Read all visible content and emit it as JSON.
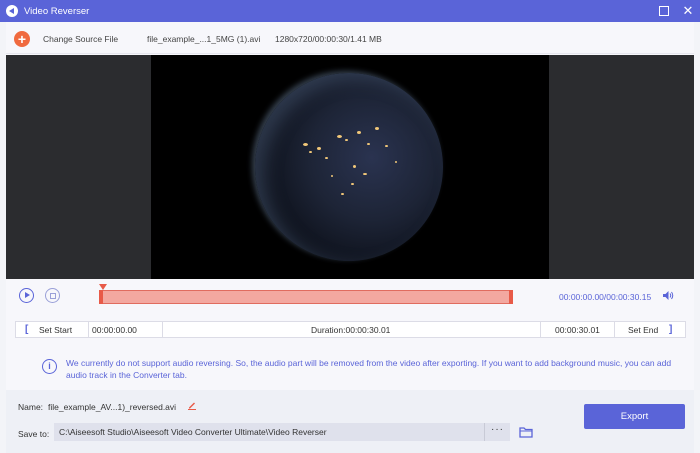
{
  "window": {
    "title": "Video Reverser"
  },
  "source": {
    "change_label": "Change Source File",
    "file_name": "file_example_...1_5MG (1).avi",
    "file_meta": "1280x720/00:00:30/1.41 MB"
  },
  "timeline": {
    "time_readout": "00:00:00.00/00:00:30.15",
    "selection_start_fraction": 0,
    "selection_end_fraction": 1
  },
  "cut": {
    "set_start_label": "Set Start",
    "start_time": "00:00:00.00",
    "duration": "Duration:00:00:30.01",
    "end_time": "00:00:30.01",
    "set_end_label": "Set End"
  },
  "notice": {
    "text": "We currently do not support audio reversing. So, the audio part will be removed from the video after exporting. If you want to add background music, you can add audio track in the Converter tab."
  },
  "output": {
    "name_label": "Name:",
    "name_value": "file_example_AV...1)_reversed.avi",
    "save_label": "Save to:",
    "save_path": "C:\\Aiseesoft Studio\\Aiseesoft Video Converter Ultimate\\Video Reverser",
    "dots_label": "···",
    "export_label": "Export"
  },
  "colors": {
    "accent": "#5a64d8",
    "add": "#f06a3f",
    "trim": "#e85a48"
  },
  "icons": [
    "app-icon",
    "plus-icon",
    "play-icon",
    "stop-icon",
    "volume-icon",
    "info-icon",
    "edit-icon",
    "folder-icon"
  ]
}
